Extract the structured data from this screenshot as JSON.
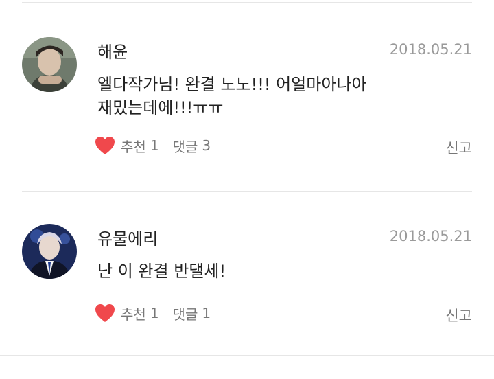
{
  "comments": [
    {
      "username": "해윤",
      "date": "2018.05.21",
      "body_lines": [
        "엘다작가님!  완결 노노!!! 어얼마아나아",
        "재밌는데에!!!ㅠㅠ"
      ],
      "like_label": "추천",
      "like_count": "1",
      "reply_label": "댓글",
      "reply_count": "3",
      "report_label": "신고",
      "avatar_icon": "user-avatar-photo",
      "heart_icon": "heart-icon",
      "heart_color": "#f0484c"
    },
    {
      "username": "유물에리",
      "date": "2018.05.21",
      "body_lines": [
        "난 이 완결 반댈세!"
      ],
      "like_label": "추천",
      "like_count": "1",
      "reply_label": "댓글",
      "reply_count": "1",
      "report_label": "신고",
      "avatar_icon": "user-avatar-photo",
      "heart_icon": "heart-icon",
      "heart_color": "#f0484c"
    }
  ]
}
